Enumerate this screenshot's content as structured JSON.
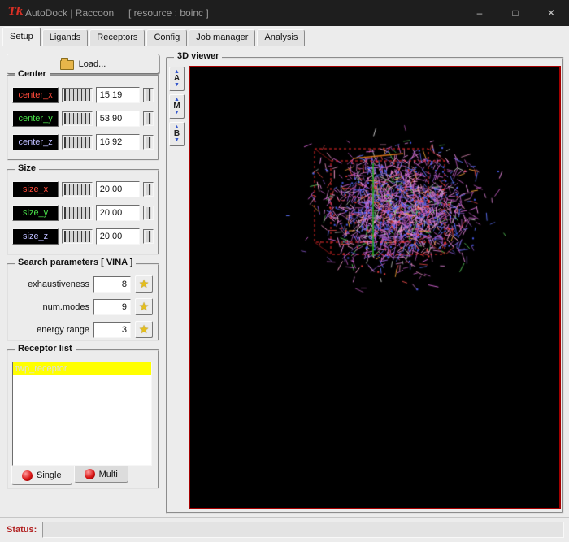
{
  "window": {
    "logo": "Tk",
    "title": "AutoDock | Raccoon",
    "resource": "[ resource : boinc ]",
    "controls": {
      "minimize": "–",
      "maximize": "□",
      "close": "✕"
    }
  },
  "tabs": [
    {
      "label": "Setup",
      "active": true
    },
    {
      "label": "Ligands",
      "active": false
    },
    {
      "label": "Receptors",
      "active": false
    },
    {
      "label": "Config",
      "active": false
    },
    {
      "label": "Job manager",
      "active": false
    },
    {
      "label": "Analysis",
      "active": false
    }
  ],
  "setup": {
    "load_button": "Load...",
    "center": {
      "title": "Center",
      "rows": [
        {
          "label": "center_x",
          "value": "15.19",
          "color": "#ff4a3a"
        },
        {
          "label": "center_y",
          "value": "53.90",
          "color": "#49eócio49"
        },
        {
          "label": "center_z",
          "value": "16.92",
          "color": "#bcbcff"
        }
      ]
    },
    "size": {
      "title": "Size",
      "rows": [
        {
          "label": "size_x",
          "value": "20.00",
          "color": "#ff4a3a"
        },
        {
          "label": "size_y",
          "value": "20.00",
          "color": "#49e049"
        },
        {
          "label": "size_z",
          "value": "20.00",
          "color": "#bcbcff"
        }
      ]
    },
    "search": {
      "title": "Search parameters [ VINA ]",
      "rows": [
        {
          "label": "exhaustiveness",
          "value": "8"
        },
        {
          "label": "num.modes",
          "value": "9"
        },
        {
          "label": "energy range",
          "value": "3"
        }
      ]
    },
    "receptors": {
      "title": "Receptor list",
      "items": [
        {
          "name": "twp_receptor",
          "selected": true
        }
      ],
      "mode_tabs": [
        {
          "label": "Single",
          "active": true
        },
        {
          "label": "Multi",
          "active": false
        }
      ]
    }
  },
  "viewer": {
    "title": "3D viewer",
    "buttons": [
      "A",
      "M",
      "B"
    ]
  },
  "status": {
    "label": "Status:",
    "value": ""
  },
  "colors": {
    "axis_x": "#ff4a3a",
    "axis_y": "#49e049",
    "axis_z": "#bcbcff",
    "selection_bg": "#ffff00",
    "viewer_border": "#a40000",
    "titlebar_bg": "#1e1e1e",
    "star": "#e4be1d"
  }
}
